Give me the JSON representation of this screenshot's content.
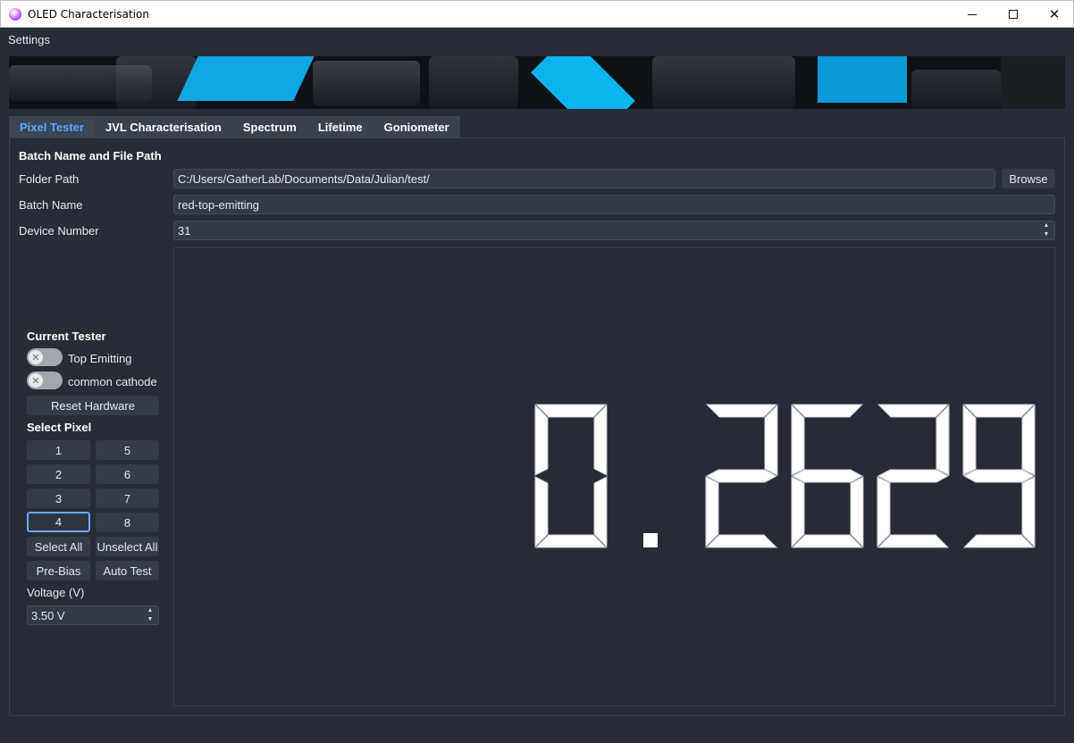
{
  "window": {
    "title": "OLED Characterisation"
  },
  "menu": {
    "settings": "Settings"
  },
  "tabs": [
    "Pixel Tester",
    "JVL Characterisation",
    "Spectrum",
    "Lifetime",
    "Goniometer"
  ],
  "batch": {
    "section_title": "Batch Name and File Path",
    "folder_label": "Folder Path",
    "folder_value": "C:/Users/GatherLab/Documents/Data/Julian/test/",
    "browse_label": "Browse",
    "batch_label": "Batch Name",
    "batch_value": "red-top-emitting",
    "device_label": "Device Number",
    "device_value": "31"
  },
  "tester": {
    "section_title": "Current Tester",
    "top_emitting": "Top Emitting",
    "common_cathode": "common cathode",
    "reset_hardware": "Reset Hardware"
  },
  "pixels": {
    "section_title": "Select Pixel",
    "buttons": [
      "1",
      "5",
      "2",
      "6",
      "3",
      "7",
      "4",
      "8"
    ],
    "select_all": "Select All",
    "unselect_all": "Unselect All",
    "pre_bias": "Pre-Bias",
    "auto_test": "Auto Test"
  },
  "voltage": {
    "label": "Voltage (V)",
    "value": "3.50 V"
  },
  "display": {
    "reading": "0.2629",
    "digits": [
      "0",
      ".",
      "2",
      "6",
      "2",
      "9"
    ]
  },
  "colors": {
    "accent": "#58a9ff",
    "background": "#272c36",
    "segment": "#ffffff"
  }
}
